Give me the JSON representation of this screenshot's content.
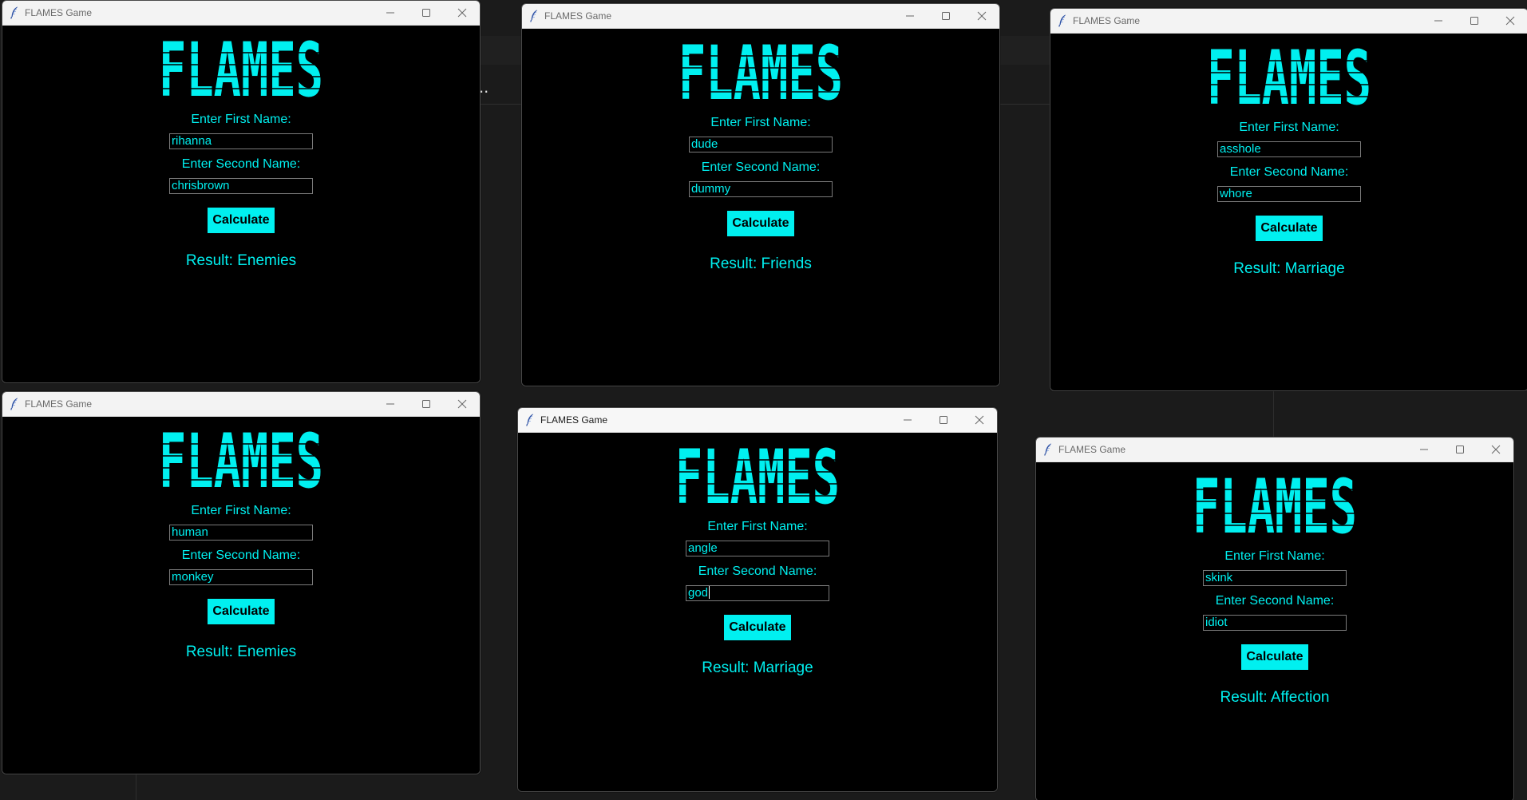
{
  "app": {
    "logo_text": "FLAMES",
    "accent_color": "#00f0f0",
    "window_background": "#000000"
  },
  "windows": [
    {
      "title": "FLAMES Game",
      "first_label": "Enter First Name:",
      "first_value": "rihanna",
      "second_label": "Enter Second Name:",
      "second_value": "chrisbrown",
      "button_label": "Calculate",
      "result": "Result: Enemies"
    },
    {
      "title": "FLAMES Game",
      "first_label": "Enter First Name:",
      "first_value": "dude",
      "second_label": "Enter Second Name:",
      "second_value": "dummy",
      "button_label": "Calculate",
      "result": "Result: Friends"
    },
    {
      "title": "FLAMES Game",
      "first_label": "Enter First Name:",
      "first_value": "asshole",
      "second_label": "Enter Second Name:",
      "second_value": "whore",
      "button_label": "Calculate",
      "result": "Result: Marriage"
    },
    {
      "title": "FLAMES Game",
      "first_label": "Enter First Name:",
      "first_value": "human",
      "second_label": "Enter Second Name:",
      "second_value": "monkey",
      "button_label": "Calculate",
      "result": "Result: Enemies"
    },
    {
      "title": "FLAMES Game",
      "first_label": "Enter First Name:",
      "first_value": "angle",
      "second_label": "Enter Second Name:",
      "second_value": "god",
      "button_label": "Calculate",
      "result": "Result: Marriage"
    },
    {
      "title": "FLAMES Game",
      "first_label": "Enter First Name:",
      "first_value": "skink",
      "second_label": "Enter Second Name:",
      "second_value": "idiot",
      "button_label": "Calculate",
      "result": "Result: Affection"
    }
  ],
  "icons": {
    "title_icon": "feather-icon",
    "minimize": "minimize-icon",
    "maximize": "maximize-icon",
    "close": "close-icon"
  }
}
